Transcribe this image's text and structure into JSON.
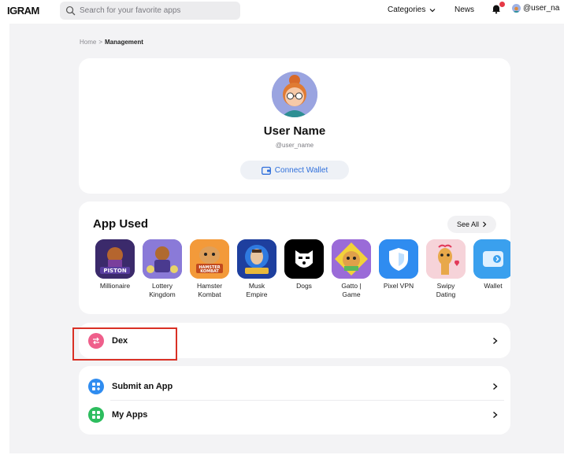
{
  "header": {
    "logo": "IGRAM",
    "search_placeholder": "Search for your favorite apps",
    "nav_categories": "Categories",
    "nav_news": "News",
    "user_handle": "@user_na"
  },
  "breadcrumb": {
    "home": "Home",
    "separator": ">",
    "current": "Management"
  },
  "profile": {
    "name": "User Name",
    "handle": "@user_name",
    "connect_wallet": "Connect Wallet"
  },
  "apps_used": {
    "title": "App Used",
    "see_all": "See All",
    "apps": [
      {
        "label_1": "Millionaire",
        "label_2": "",
        "icon": "piston-icon",
        "color": "#3b2a6b"
      },
      {
        "label_1": "Lottery",
        "label_2": "Kingdom",
        "icon": "lottery-kingdom-icon",
        "color": "#6b58c7"
      },
      {
        "label_1": "Hamster",
        "label_2": "Kombat",
        "icon": "hamster-kombat-icon",
        "color": "#f08a2a"
      },
      {
        "label_1": "Musk",
        "label_2": "Empire",
        "icon": "musk-empire-icon",
        "color": "#1f4fb8"
      },
      {
        "label_1": "Dogs",
        "label_2": "",
        "icon": "dogs-icon",
        "color": "#000000"
      },
      {
        "label_1": "Gatto |",
        "label_2": "Game",
        "icon": "gatto-icon",
        "color": "#8e5bd1"
      },
      {
        "label_1": "Pixel VPN",
        "label_2": "",
        "icon": "pixel-vpn-icon",
        "color": "#2f8cf0"
      },
      {
        "label_1": "Swipy",
        "label_2": "Dating",
        "icon": "swipy-dating-icon",
        "color": "#f3c6cf"
      },
      {
        "label_1": "Wallet",
        "label_2": "",
        "icon": "wallet-app-icon",
        "color": "#3aa0ee"
      }
    ]
  },
  "dex": {
    "label": "Dex",
    "icon": "dex-icon",
    "color": "#ef5f8b"
  },
  "links": [
    {
      "label": "Submit an App",
      "icon": "submit-app-icon",
      "color": "#2f8cf0"
    },
    {
      "label": "My Apps",
      "icon": "my-apps-icon",
      "color": "#2dbd5e"
    }
  ],
  "highlight_color": "#d93025"
}
